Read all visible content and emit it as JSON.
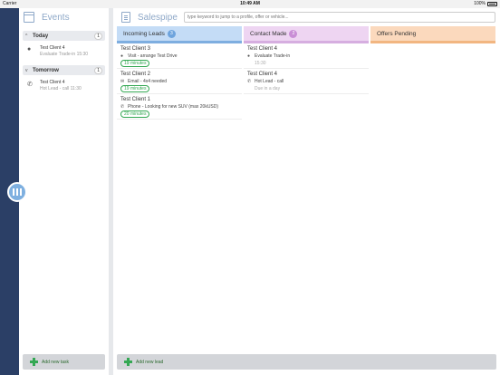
{
  "statusbar": {
    "carrier": "Carrier",
    "time": "10:49 AM",
    "battery": "100%"
  },
  "events": {
    "title": "Events",
    "sections": [
      {
        "label": "Today",
        "count": "1",
        "items": [
          {
            "name": "Test Client 4",
            "sub": "Evaluate Trade-in  15:30",
            "icon": "pin-icon"
          }
        ]
      },
      {
        "label": "Tomorrow",
        "count": "1",
        "items": [
          {
            "name": "Test Client 4",
            "sub": "Hot Lead - call  11:30",
            "icon": "phone-icon"
          }
        ]
      }
    ],
    "add_label": "Add new task"
  },
  "salespipe": {
    "title": "Salespipe",
    "search_placeholder": "type keyword to jump to a profile, offer or vehicle...",
    "columns": [
      {
        "label": "Incoming Leads",
        "count": "3",
        "color": "#c4dcf6",
        "cards": [
          {
            "name": "Test Client 3",
            "detail": "Visit - arrange Test Drive",
            "chip": "19 minutes"
          },
          {
            "name": "Test Client 2",
            "detail": "Email - 4x4 needed",
            "chip": "19 minutes"
          },
          {
            "name": "Test Client 1",
            "detail": "Phone - Looking for new SUV (max 20kUSD)",
            "chip": "20 minutes"
          }
        ]
      },
      {
        "label": "Contact Made",
        "count": "2",
        "color": "#eed5f2",
        "cards": [
          {
            "name": "Test Client 4",
            "detail": "Evaluate Trade-in",
            "due": "15:30"
          },
          {
            "name": "Test Client 4",
            "detail": "Hot Lead - call",
            "due": "Due in a day"
          }
        ]
      },
      {
        "label": "Offers Pending",
        "color": "#fbd9bd"
      }
    ],
    "add_label": "Add new lead"
  }
}
